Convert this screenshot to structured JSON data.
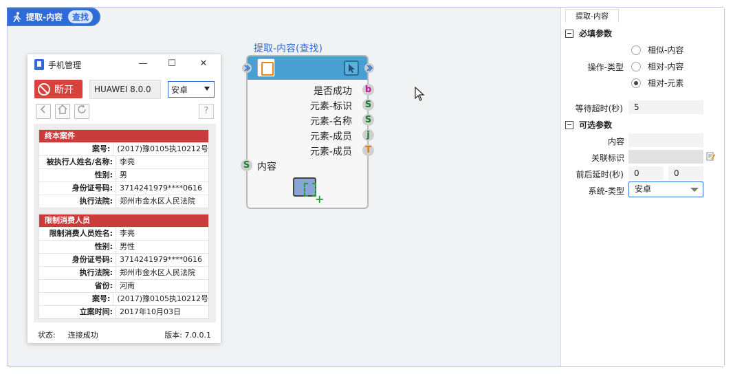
{
  "title_pill": {
    "label": "提取-内容",
    "badge": "查找"
  },
  "phone_manager": {
    "title": "手机管理",
    "window_buttons": {
      "minimize": "—",
      "maximize": "☐",
      "close": "✕"
    },
    "disconnect_label": "断开",
    "device": "HUAWEI 8.0.0",
    "os_selected": "安卓",
    "help": "?",
    "cards": [
      {
        "header": "终本案件",
        "rows": [
          {
            "k": "案号:",
            "v": "(2017)豫0105执10212号"
          },
          {
            "k": "被执行人姓名/名称:",
            "v": "李亮"
          },
          {
            "k": "性别:",
            "v": "男"
          },
          {
            "k": "身份证号码:",
            "v": "3714241979****0616"
          },
          {
            "k": "执行法院:",
            "v": "郑州市金水区人民法院"
          }
        ]
      },
      {
        "header": "限制消费人员",
        "rows": [
          {
            "k": "限制消费人员姓名:",
            "v": "李亮"
          },
          {
            "k": "性别:",
            "v": "男性"
          },
          {
            "k": "身份证号码:",
            "v": "3714241979****0616"
          },
          {
            "k": "执行法院:",
            "v": "郑州市金水区人民法院"
          },
          {
            "k": "省份:",
            "v": "河南"
          },
          {
            "k": "案号:",
            "v": "(2017)豫0105执10212号"
          },
          {
            "k": "立案时间:",
            "v": "2017年10月03日"
          }
        ]
      }
    ],
    "status_label": "状态:",
    "status_value": "连接成功",
    "version": "版本: 7.0.0.1"
  },
  "node": {
    "title": "提取-内容(查找)",
    "outputs": [
      {
        "label": "是否成功",
        "type": "b",
        "color": "#c0189a"
      },
      {
        "label": "元素-标识",
        "type": "S",
        "color": "#1e7c2f"
      },
      {
        "label": "元素-名称",
        "type": "S",
        "color": "#1e7c2f"
      },
      {
        "label": "元素-成员",
        "type": "j",
        "color": "#1e7c2f"
      },
      {
        "label": "元素-成员",
        "type": "T",
        "color": "#e07b12"
      }
    ],
    "input": {
      "label": "内容",
      "type": "S"
    }
  },
  "right_panel": {
    "tab": "提取-内容",
    "required_section": "必填参数",
    "op_type_label": "操作-类型",
    "op_options": [
      {
        "label": "相似-内容",
        "checked": false
      },
      {
        "label": "相对-内容",
        "checked": false
      },
      {
        "label": "相对-元素",
        "checked": true
      }
    ],
    "timeout_label": "等待超时(秒)",
    "timeout_value": "5",
    "optional_section": "可选参数",
    "content_label": "内容",
    "content_value": "",
    "assoc_label": "关联标识",
    "assoc_value": "",
    "delay_label": "前后延时(秒)",
    "delay_before": "0",
    "delay_after": "0",
    "sys_type_label": "系统-类型",
    "sys_type_value": "安卓"
  }
}
